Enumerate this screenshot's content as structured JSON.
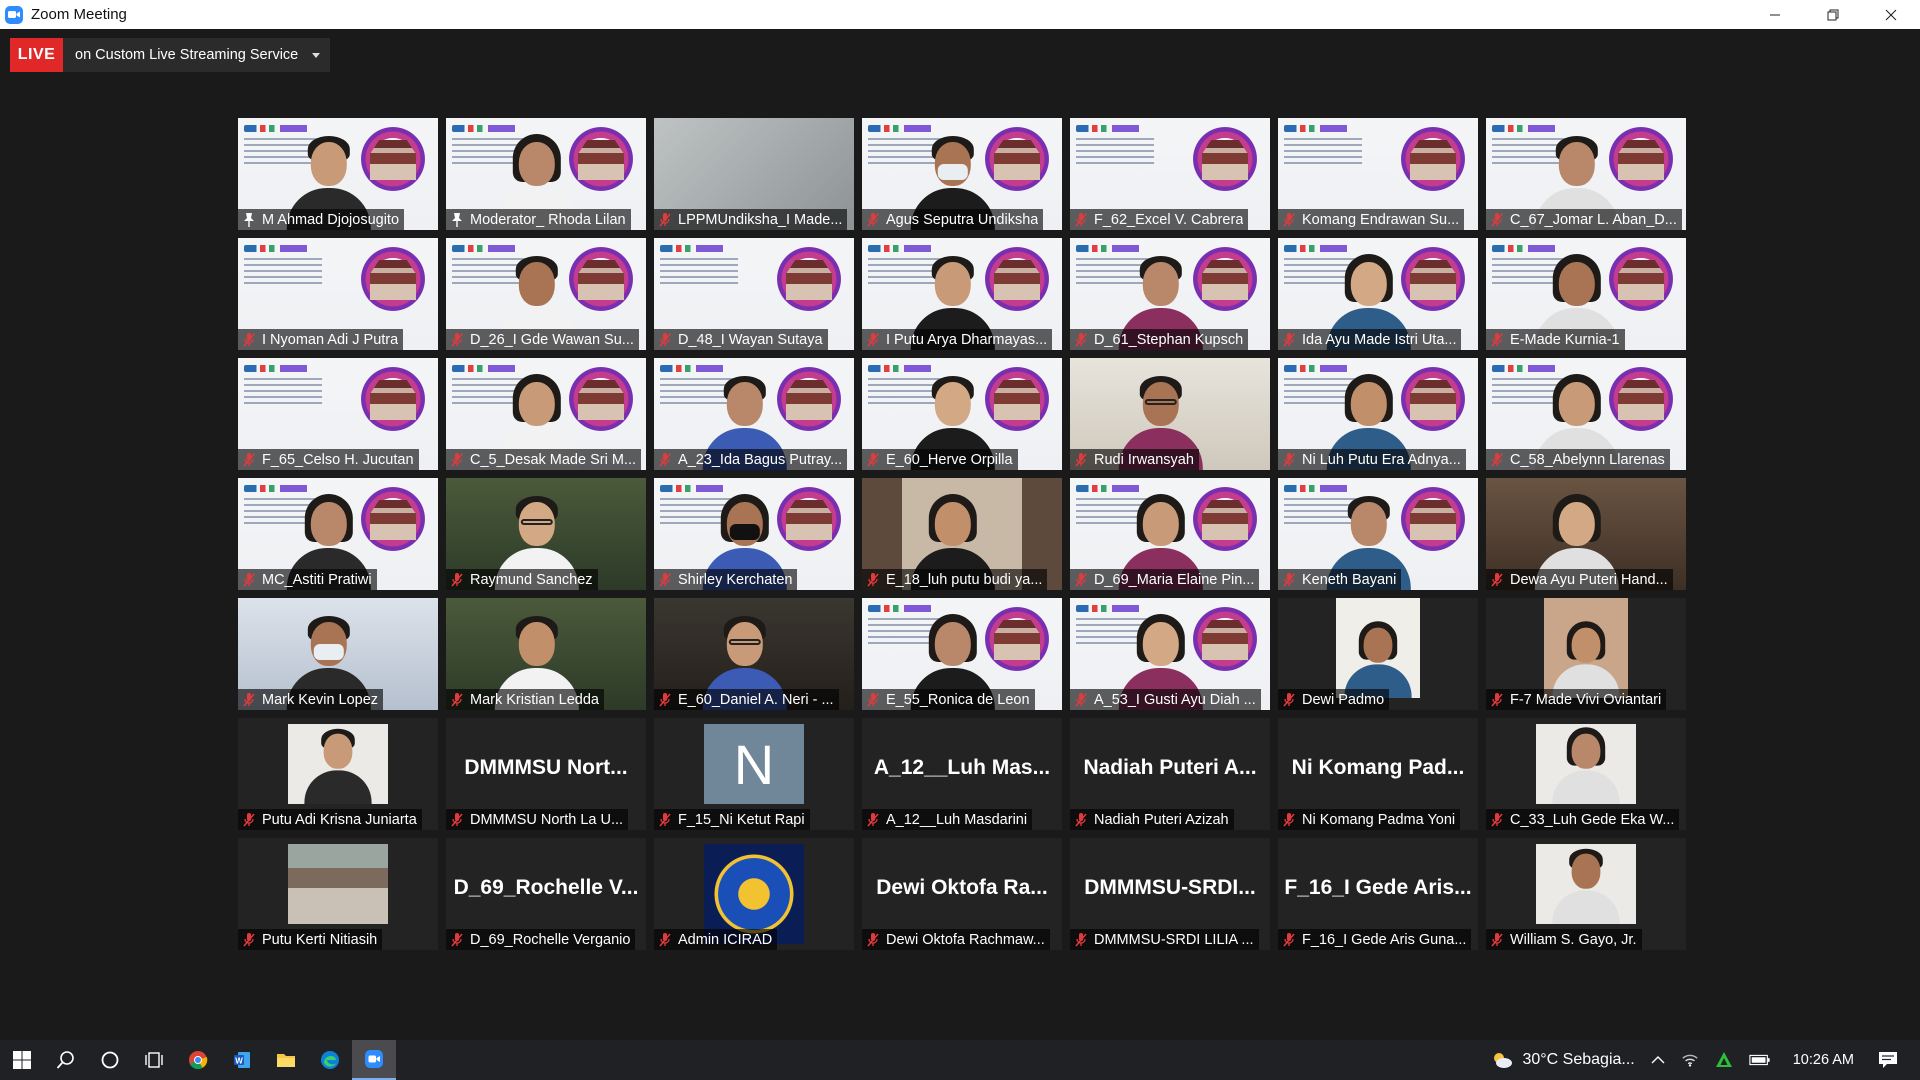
{
  "window": {
    "title": "Zoom Meeting"
  },
  "live": {
    "badge": "LIVE",
    "service": "on Custom Live Streaming Service"
  },
  "participants": [
    {
      "name": "M Ahmad Djojosugito",
      "bg": "slide",
      "person": "m",
      "mic": "host"
    },
    {
      "name": "Moderator_ Rhoda Lilan",
      "bg": "slide",
      "person": "f",
      "mic": "host",
      "active": true
    },
    {
      "name": "LPPMUndiksha_I Made...",
      "bg": "relief",
      "person": "",
      "mic": "muted"
    },
    {
      "name": "Agus Seputra Undiksha",
      "bg": "slide",
      "person": "m-mask",
      "mic": "muted"
    },
    {
      "name": "F_62_Excel V. Cabrera",
      "bg": "slide",
      "person": "",
      "mic": "muted"
    },
    {
      "name": "Komang Endrawan Su...",
      "bg": "slide",
      "person": "",
      "mic": "muted"
    },
    {
      "name": "C_67_Jomar L. Aban_D...",
      "bg": "slide",
      "person": "m",
      "mic": "muted"
    },
    {
      "name": "I Nyoman Adi J Putra",
      "bg": "slide",
      "person": "",
      "mic": "muted"
    },
    {
      "name": "D_26_I Gde Wawan Su...",
      "bg": "slide",
      "person": "m",
      "mic": "muted"
    },
    {
      "name": "D_48_I Wayan Sutaya",
      "bg": "slide",
      "person": "",
      "mic": "muted"
    },
    {
      "name": "I Putu Arya Dharmayas...",
      "bg": "slide",
      "person": "m",
      "mic": "muted"
    },
    {
      "name": "D_61_Stephan Kupsch",
      "bg": "slide",
      "person": "m",
      "mic": "muted"
    },
    {
      "name": "Ida Ayu Made Istri Uta...",
      "bg": "slide",
      "person": "f",
      "mic": "muted"
    },
    {
      "name": "E-Made Kurnia-1",
      "bg": "slide",
      "person": "f",
      "mic": "muted"
    },
    {
      "name": "F_65_Celso H. Jucutan",
      "bg": "slide",
      "person": "",
      "mic": "muted"
    },
    {
      "name": "C_5_Desak Made Sri M...",
      "bg": "slide",
      "person": "f",
      "mic": "muted"
    },
    {
      "name": "A_23_Ida Bagus Putray...",
      "bg": "slide",
      "person": "m",
      "mic": "muted"
    },
    {
      "name": "E_60_Herve Orpilla",
      "bg": "slide",
      "person": "m",
      "mic": "muted"
    },
    {
      "name": "Rudi Irwansyah",
      "bg": "room",
      "person": "m-glasses",
      "mic": "muted"
    },
    {
      "name": "Ni Luh Putu Era Adnya...",
      "bg": "slide",
      "person": "f",
      "mic": "muted"
    },
    {
      "name": "C_58_Abelynn Llarenas",
      "bg": "slide",
      "person": "f",
      "mic": "muted"
    },
    {
      "name": "MC_Astiti Pratiwi",
      "bg": "slide",
      "person": "f",
      "mic": "muted"
    },
    {
      "name": "Raymund Sanchez",
      "bg": "green",
      "person": "m-glasses",
      "mic": "muted"
    },
    {
      "name": "Shirley Kerchaten",
      "bg": "slide",
      "person": "f-mask",
      "mic": "muted"
    },
    {
      "name": "E_18_luh putu budi ya...",
      "bg": "window",
      "person": "f",
      "mic": "muted"
    },
    {
      "name": "D_69_Maria Elaine Pin...",
      "bg": "slide",
      "person": "f",
      "mic": "muted"
    },
    {
      "name": "Keneth Bayani",
      "bg": "slide",
      "person": "m",
      "mic": "muted"
    },
    {
      "name": "Dewa Ayu Puteri Hand...",
      "bg": "warm",
      "person": "f",
      "mic": "muted"
    },
    {
      "name": "Mark Kevin Lopez",
      "bg": "blue",
      "person": "m-mask",
      "mic": "muted"
    },
    {
      "name": "Mark Kristian Ledda",
      "bg": "green",
      "person": "m",
      "mic": "muted"
    },
    {
      "name": "E_60_Daniel A. Neri - ...",
      "bg": "dark",
      "person": "m-glasses",
      "mic": "muted"
    },
    {
      "name": "E_55_Ronica de Leon",
      "bg": "slide",
      "person": "f",
      "mic": "muted"
    },
    {
      "name": "A_53_I Gusti Ayu Diah ...",
      "bg": "slide",
      "person": "f",
      "mic": "muted"
    },
    {
      "name": "Dewi Padmo",
      "bg": "photo-tall",
      "person": "f",
      "mic": "muted"
    },
    {
      "name": "F-7 Made Vivi Oviantari",
      "bg": "photo-tall",
      "person": "f",
      "mic": "muted"
    },
    {
      "name": "Putu Adi Krisna Juniarta",
      "bg": "photo",
      "person": "m",
      "mic": "muted"
    },
    {
      "name": "DMMMSU North La U...",
      "bg": "text",
      "display": "DMMMSU Nort...",
      "mic": "muted"
    },
    {
      "name": "F_15_Ni Ketut Rapi",
      "bg": "avatar",
      "display": "N",
      "mic": "muted"
    },
    {
      "name": "A_12__Luh Masdarini",
      "bg": "text",
      "display": "A_12__Luh Mas...",
      "mic": "muted"
    },
    {
      "name": "Nadiah Puteri Azizah",
      "bg": "text",
      "display": "Nadiah Puteri A...",
      "mic": "muted"
    },
    {
      "name": "Ni Komang Padma Yoni",
      "bg": "text",
      "display": "Ni Komang Pad...",
      "mic": "muted"
    },
    {
      "name": "C_33_Luh Gede Eka W...",
      "bg": "photo",
      "person": "f",
      "mic": "muted"
    },
    {
      "name": "Putu Kerti Nitiasih",
      "bg": "photo-building",
      "person": "",
      "mic": "muted"
    },
    {
      "name": "D_69_Rochelle Verganio",
      "bg": "text",
      "display": "D_69_Rochelle V...",
      "mic": "muted"
    },
    {
      "name": "Admin ICIRAD",
      "bg": "logo",
      "mic": "muted"
    },
    {
      "name": "Dewi Oktofa Rachmaw...",
      "bg": "text",
      "display": "Dewi Oktofa Ra...",
      "mic": "muted"
    },
    {
      "name": "DMMMSU-SRDI LILIA ...",
      "bg": "text",
      "display": "DMMMSU-SRDI...",
      "mic": "muted"
    },
    {
      "name": "F_16_I Gede Aris Guna...",
      "bg": "text",
      "display": "F_16_I Gede Aris...",
      "mic": "muted"
    },
    {
      "name": "William S. Gayo, Jr.",
      "bg": "photo",
      "person": "m",
      "mic": "muted"
    }
  ],
  "taskbar": {
    "apps": [
      "start-icon",
      "search-icon",
      "cortana-icon",
      "task-view-icon",
      "chrome-icon",
      "word-icon",
      "file-explorer-icon",
      "edge-icon",
      "zoom-icon"
    ],
    "weather": "30°C  Sebagia...",
    "clock": "10:26 AM"
  }
}
